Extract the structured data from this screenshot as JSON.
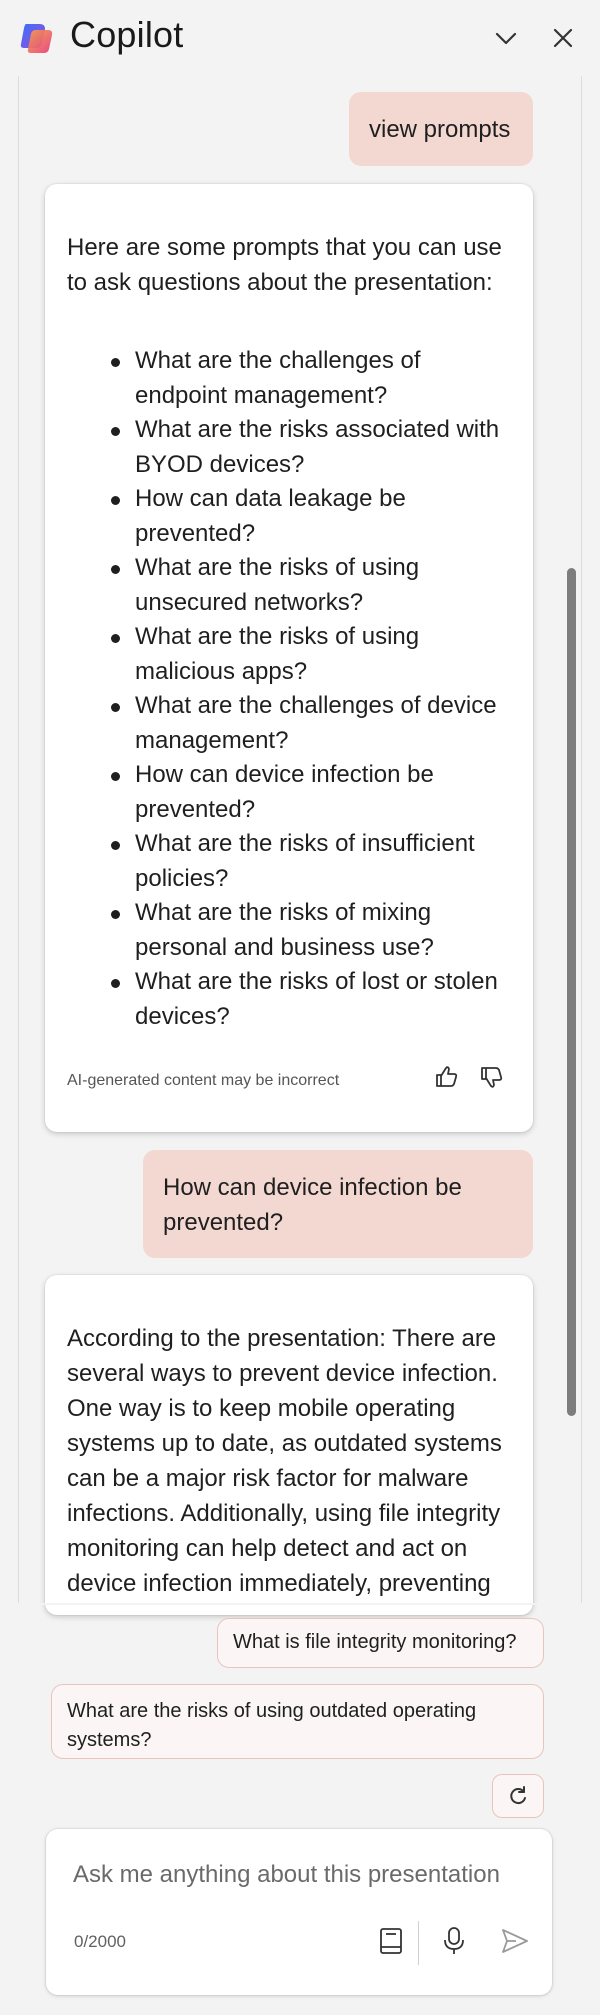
{
  "app": {
    "title": "Copilot"
  },
  "header": {
    "icons": [
      "copilot-logo",
      "chevron-down-icon",
      "close-icon"
    ]
  },
  "conversation": {
    "user_message_1": "view prompts",
    "ai_response_1": {
      "intro": "Here are some prompts that you can use to ask questions about the presentation:",
      "prompts": [
        "What are the challenges of endpoint management?",
        "What are the risks associated with BYOD devices?",
        "How can data leakage be prevented?",
        "What are the risks of using unsecured networks?",
        "What are the risks of using malicious apps?",
        "What are the challenges of device management?",
        "How can device infection be prevented?",
        "What are the risks of insufficient policies?",
        "What are the risks of mixing personal and business use?",
        "What are the risks of lost or stolen devices?"
      ],
      "disclaimer": "AI-generated content may be incorrect",
      "feedback_icons": [
        "thumbs-up-icon",
        "thumbs-down-icon"
      ]
    },
    "user_message_2": "How can device infection be prevented?",
    "ai_response_2": {
      "text": "According to the presentation: There are several ways to prevent device infection. One way is to keep mobile operating systems up to date, as outdated systems can be a major risk factor for malware infections. Additionally, using file integrity monitoring can help detect and act on device infection immediately, preventing"
    }
  },
  "suggestions": [
    "What is file integrity monitoring?",
    "What are the risks of using outdated operating systems?"
  ],
  "composer": {
    "placeholder": "Ask me anything about this presentation",
    "char_count": "0/2000",
    "icons": [
      "notebook-icon",
      "microphone-icon",
      "send-icon",
      "refresh-icon"
    ]
  },
  "colors": {
    "user_bubble": "#f3d8d2",
    "chip_border": "#e8c5bc",
    "background": "#f3f3f3",
    "scroll_thumb": "#7d7d7d"
  }
}
